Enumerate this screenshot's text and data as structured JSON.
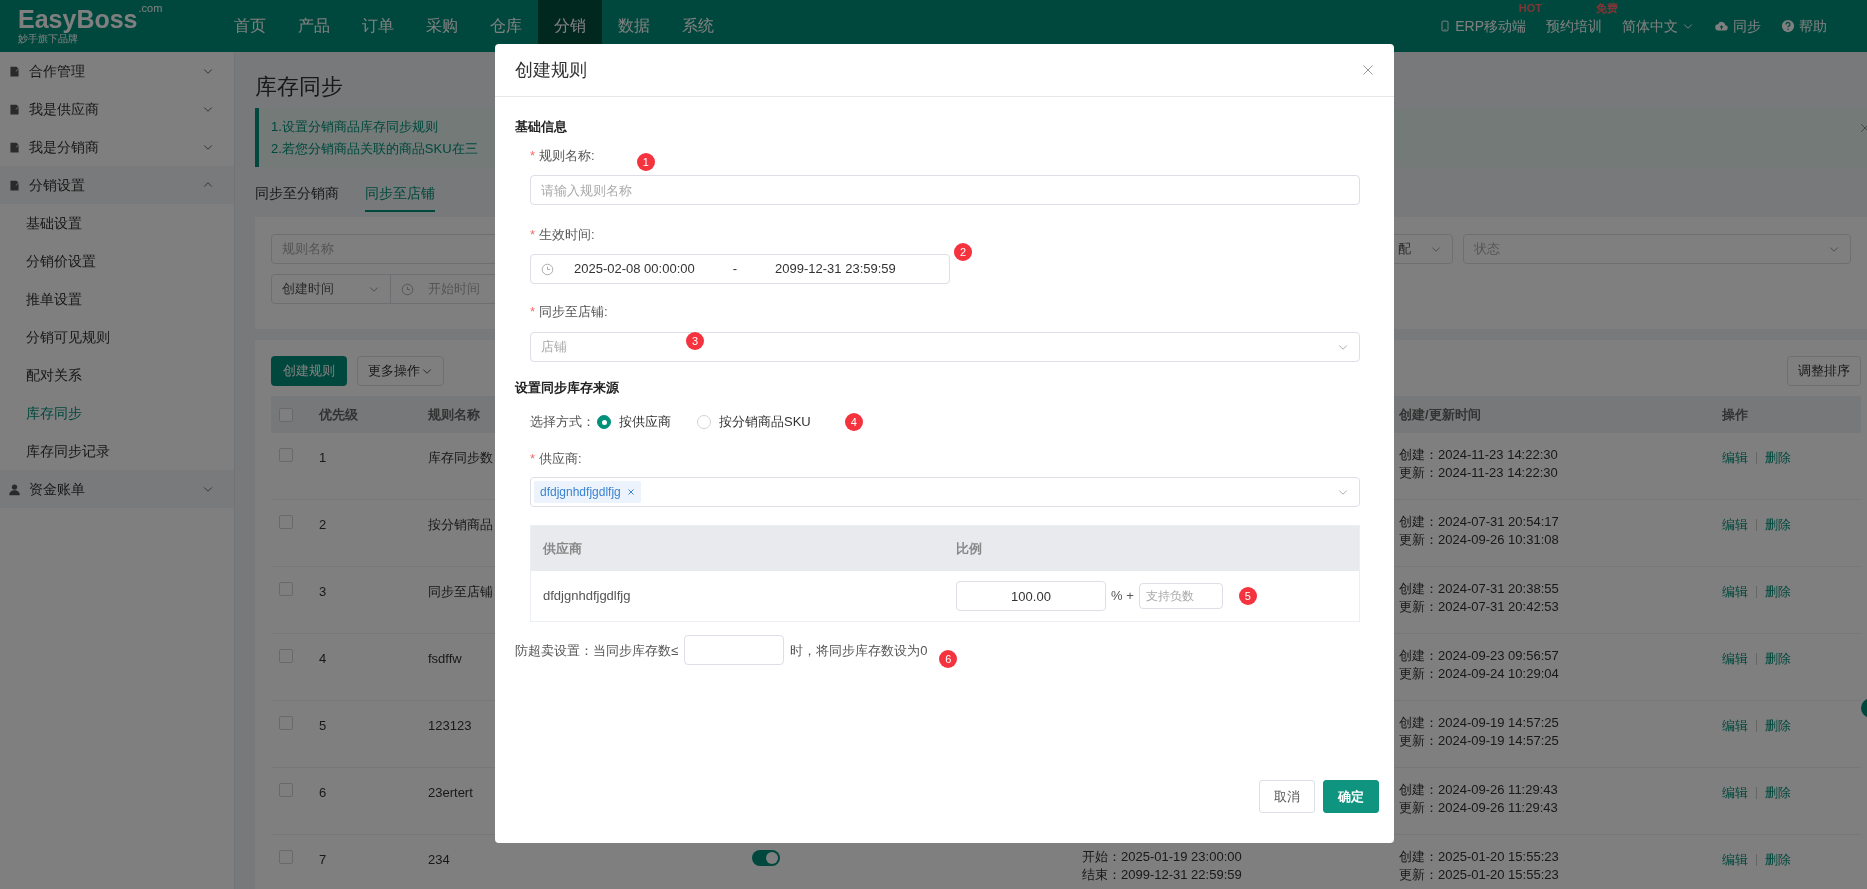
{
  "header": {
    "logo": "EasyBoss",
    "logo_suffix": ".com",
    "tagline": "妙手旗下品牌",
    "nav": [
      {
        "label": "首页",
        "selected": false
      },
      {
        "label": "产品",
        "selected": false
      },
      {
        "label": "订单",
        "selected": false
      },
      {
        "label": "采购",
        "selected": false
      },
      {
        "label": "仓库",
        "selected": false
      },
      {
        "label": "分销",
        "selected": true
      },
      {
        "label": "数据",
        "selected": false
      },
      {
        "label": "系统",
        "selected": false
      }
    ],
    "tools": [
      {
        "kind": "mobile",
        "label": "ERP移动端",
        "badge": "HOT"
      },
      {
        "kind": "plain",
        "label": "预约培训",
        "badge": "免费"
      },
      {
        "kind": "language",
        "label": "简体中文"
      },
      {
        "kind": "sync",
        "label": "同步"
      },
      {
        "kind": "help",
        "label": "帮助"
      }
    ]
  },
  "sidebar": [
    {
      "kind": "folder",
      "label": "合作管理",
      "expanded": false
    },
    {
      "kind": "folder",
      "label": "我是供应商",
      "expanded": false
    },
    {
      "kind": "folder",
      "label": "我是分销商",
      "expanded": false
    },
    {
      "kind": "folder",
      "label": "分销设置",
      "expanded": true,
      "children": [
        {
          "label": "基础设置",
          "selected": false
        },
        {
          "label": "分销价设置",
          "selected": false
        },
        {
          "label": "推单设置",
          "selected": false
        },
        {
          "label": "分销可见规则",
          "selected": false
        },
        {
          "label": "配对关系",
          "selected": false
        },
        {
          "label": "库存同步",
          "selected": true
        },
        {
          "label": "库存同步记录",
          "selected": false
        }
      ]
    },
    {
      "kind": "user",
      "label": "资金账单",
      "expanded": false
    }
  ],
  "page": {
    "title": "库存同步",
    "notice": [
      "1.设置分销商品库存同步规则",
      "2.若您分销商品关联的商品SKU在三"
    ],
    "tabs": [
      {
        "label": "同步至分销商",
        "selected": false
      },
      {
        "label": "同步至店铺",
        "selected": true
      }
    ],
    "filters": {
      "rule_name_placeholder": "规则名称",
      "match_select": "配",
      "status_placeholder": "状态",
      "time_type": "创建时间",
      "start_placeholder": "开始时间"
    },
    "actions": {
      "create": "创建规则",
      "more": "更多操作",
      "sort": "调整排序"
    },
    "table": {
      "all_selected": false,
      "columns": {
        "priority": "优先级",
        "name": "规则名称",
        "times": "创建/更新时间",
        "ops": "操作"
      },
      "rows": [
        {
          "selected": false,
          "priority": "1",
          "name": "库存同步数",
          "created": "创建：2024-11-23 14:22:30",
          "updated": "更新：2024-11-23 14:22:30",
          "edit": "编辑",
          "delete": "删除"
        },
        {
          "selected": false,
          "priority": "2",
          "name": "按分销商品",
          "created": "创建：2024-07-31 20:54:17",
          "updated": "更新：2024-09-26 10:31:08",
          "edit": "编辑",
          "delete": "删除"
        },
        {
          "selected": false,
          "priority": "3",
          "name": "同步至店铺",
          "created": "创建：2024-07-31 20:38:55",
          "updated": "更新：2024-07-31 20:42:53",
          "edit": "编辑",
          "delete": "删除"
        },
        {
          "selected": false,
          "priority": "4",
          "name": "fsdffw",
          "created": "创建：2024-09-23 09:56:57",
          "updated": "更新：2024-09-24 10:29:04",
          "edit": "编辑",
          "delete": "删除"
        },
        {
          "selected": false,
          "priority": "5",
          "name": "123123",
          "created": "创建：2024-09-19 14:57:25",
          "updated": "更新：2024-09-19 14:57:25",
          "edit": "编辑",
          "delete": "删除"
        },
        {
          "selected": false,
          "priority": "6",
          "name": "23ertert",
          "created": "创建：2024-09-26 11:29:43",
          "updated": "更新：2024-09-26 11:29:43",
          "edit": "编辑",
          "delete": "删除"
        },
        {
          "selected": false,
          "priority": "7",
          "name": "234",
          "on": true,
          "start": "开始：2025-01-19 23:00:00",
          "end": "结束：2099-12-31 22:59:59",
          "created": "创建：2025-01-20 15:55:23",
          "updated": "更新：2025-01-20 15:55:23",
          "edit": "编辑",
          "delete": "删除"
        }
      ]
    }
  },
  "dialog": {
    "title": "创建规则",
    "basic_heading": "基础信息",
    "rule_name": {
      "required_mark": "*",
      "label": "规则名称:",
      "placeholder": "请输入规则名称",
      "marker": "1"
    },
    "effective_time": {
      "required_mark": "*",
      "label": "生效时间:",
      "start": "2025-02-08 00:00:00",
      "separator": "-",
      "end": "2099-12-31 23:59:59",
      "marker": "2"
    },
    "store": {
      "required_mark": "*",
      "label": "同步至店铺:",
      "placeholder": "店铺",
      "marker": "3"
    },
    "source_heading": "设置同步库存来源",
    "method": {
      "label": "选择方式：",
      "options": [
        {
          "label": "按供应商",
          "selected": true
        },
        {
          "label": "按分销商品SKU",
          "selected": false
        }
      ],
      "marker": "4"
    },
    "supplier": {
      "required_mark": "*",
      "label": "供应商:",
      "tags": [
        "dfdjgnhdfjgdlfjg"
      ]
    },
    "ratio_table": {
      "columns": [
        "供应商",
        "比例"
      ],
      "rows": [
        {
          "supplier": "dfdjgnhdfjgdlfjg",
          "percent": "100.00",
          "percent_suffix": "% +",
          "offset_placeholder": "支持负数"
        }
      ],
      "marker": "5"
    },
    "oversell": {
      "before": "防超卖设置：当同步库存数≤",
      "after": "时，将同步库存数设为0",
      "marker": "6"
    },
    "buttons": [
      {
        "kind": "secondary",
        "label": "取消"
      },
      {
        "kind": "primary",
        "label": "确定"
      }
    ]
  }
}
